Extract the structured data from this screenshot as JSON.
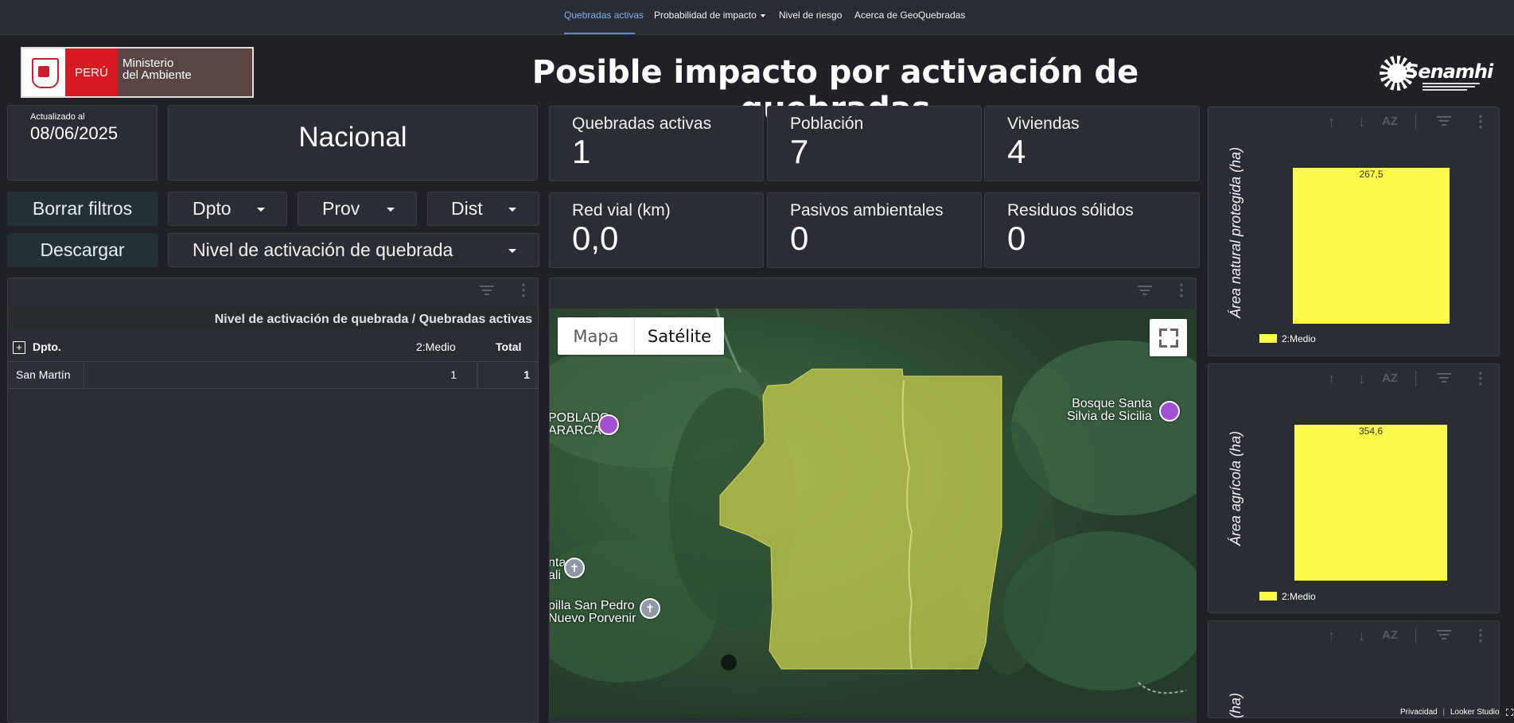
{
  "nav": {
    "items": [
      {
        "label": "Quebradas activas"
      },
      {
        "label": "Probabilidad de impacto"
      },
      {
        "label": "Nivel de riesgo"
      },
      {
        "label": "Acerca de GeoQuebradas"
      }
    ]
  },
  "header": {
    "title": "Posible impacto por activación de quebradas",
    "logo_peru": "PERÚ",
    "logo_ministerio_1": "Ministerio",
    "logo_ministerio_2": "del Ambiente",
    "logo_senamhi": "Senamhi"
  },
  "update": {
    "label": "Actualizado al",
    "date": "08/06/2025"
  },
  "scope": {
    "value": "Nacional"
  },
  "kpis": [
    {
      "label": "Quebradas activas",
      "value": "1"
    },
    {
      "label": "Población",
      "value": "7"
    },
    {
      "label": "Viviendas",
      "value": "4"
    },
    {
      "label": "Red vial (km)",
      "value": "0,0"
    },
    {
      "label": "Pasivos ambientales",
      "value": "0"
    },
    {
      "label": "Residuos sólidos",
      "value": "0"
    }
  ],
  "filters": {
    "clear_label": "Borrar filtros",
    "download_label": "Descargar",
    "dpto": "Dpto",
    "prov": "Prov",
    "dist": "Dist",
    "nivel": "Nivel de activación de quebrada"
  },
  "table": {
    "title": "Nivel de activación de quebrada / Quebradas activas",
    "expand_symbol": "+",
    "col_dpto": "Dpto.",
    "col_medio": "2:Medio",
    "col_total": "Total",
    "rows": [
      {
        "dpto": "San Martín",
        "medio": "1",
        "total": "1"
      }
    ]
  },
  "map": {
    "btn_map": "Mapa",
    "btn_sat": "Satélite",
    "poi1": "POBLADO\nARARCA",
    "poi2": "Bosque Santa\nSilvia de Sicilia",
    "poi3": "nta\nali",
    "poi4": "pilla San Pedro\nNuevo Porvenir"
  },
  "footer": {
    "privacy": "Privacidad",
    "brand": "Looker Studio"
  },
  "chart_data": [
    {
      "type": "bar",
      "categories": [
        ""
      ],
      "series": [
        {
          "name": "2:Medio",
          "values": [
            267.5
          ]
        }
      ],
      "value_labels": [
        "267,5"
      ],
      "ylabel": "Área natural protegida (ha)",
      "color": "#fbfb4c"
    },
    {
      "type": "bar",
      "categories": [
        ""
      ],
      "series": [
        {
          "name": "2:Medio",
          "values": [
            354.6
          ]
        }
      ],
      "value_labels": [
        "354,6"
      ],
      "ylabel": "Área agrícola (ha)",
      "color": "#fbfb4c"
    },
    {
      "type": "bar",
      "categories": [],
      "series": [],
      "ylabel": "(ha)"
    }
  ]
}
